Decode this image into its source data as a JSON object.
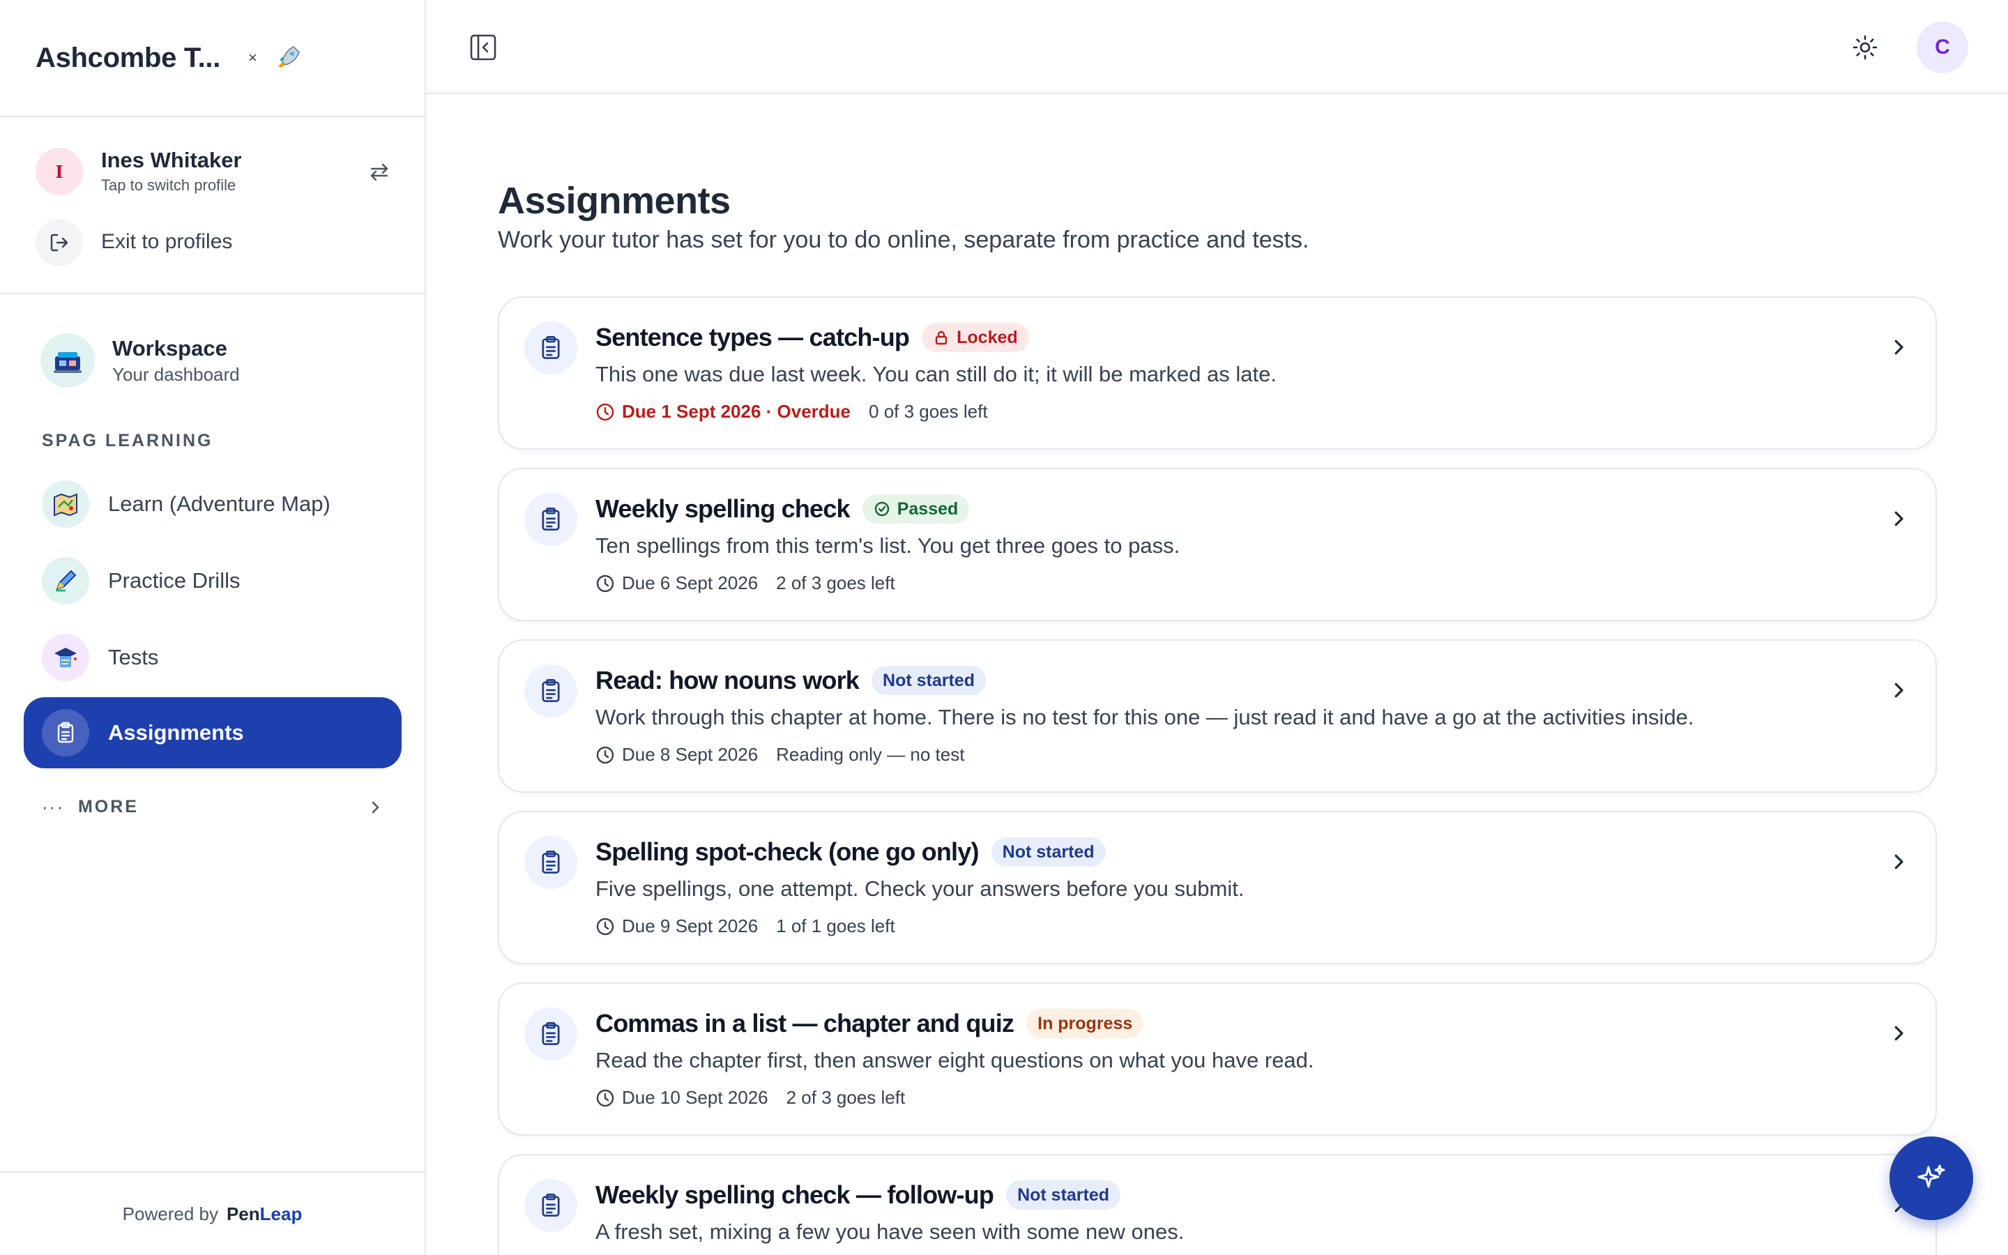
{
  "brand": {
    "title": "Ashcombe T...",
    "close_glyph": "×",
    "rocket_icon": "rocket-icon"
  },
  "profile": {
    "initial": "I",
    "name": "Ines Whitaker",
    "hint": "Tap to switch profile",
    "exit_label": "Exit to profiles"
  },
  "nav": {
    "workspace": {
      "title": "Workspace",
      "subtitle": "Your dashboard"
    },
    "section_label": "SPAG LEARNING",
    "items": [
      {
        "label": "Learn (Adventure Map)",
        "icon": "map-icon"
      },
      {
        "label": "Practice Drills",
        "icon": "pencil-icon"
      },
      {
        "label": "Tests",
        "icon": "graduation-cap-icon"
      },
      {
        "label": "Assignments",
        "icon": "clipboard-icon",
        "active": true
      }
    ],
    "more_label": "MORE",
    "more_dots": "···"
  },
  "footer": {
    "powered_by": "Powered by",
    "brand_pen": "Pen",
    "brand_leap": "Leap"
  },
  "topbar": {
    "user_initial": "C"
  },
  "page": {
    "title": "Assignments",
    "subtitle": "Work your tutor has set for you to do online, separate from practice and tests."
  },
  "assignments": [
    {
      "title": "Sentence types — catch-up",
      "status": "Locked",
      "description": "This one was due last week. You can still do it; it will be marked as late.",
      "due": "Due 1 Sept 2026 · Overdue",
      "extra": "0 of 3 goes left"
    },
    {
      "title": "Weekly spelling check",
      "status": "Passed",
      "description": "Ten spellings from this term's list. You get three goes to pass.",
      "due": "Due 6 Sept 2026",
      "extra": "2 of 3 goes left"
    },
    {
      "title": "Read: how nouns work",
      "status": "Not started",
      "description": "Work through this chapter at home. There is no test for this one — just read it and have a go at the activities inside.",
      "due": "Due 8 Sept 2026",
      "extra": "Reading only — no test"
    },
    {
      "title": "Spelling spot-check (one go only)",
      "status": "Not started",
      "description": "Five spellings, one attempt. Check your answers before you submit.",
      "due": "Due 9 Sept 2026",
      "extra": "1 of 1 goes left"
    },
    {
      "title": "Commas in a list — chapter and quiz",
      "status": "In progress",
      "description": "Read the chapter first, then answer eight questions on what you have read.",
      "due": "Due 10 Sept 2026",
      "extra": "2 of 3 goes left"
    },
    {
      "title": "Weekly spelling check — follow-up",
      "status": "Not started",
      "description": "A fresh set, mixing a few you have seen with some new ones.",
      "due": "",
      "extra": ""
    }
  ],
  "colors": {
    "accent": "#1e40af",
    "locked": "#b91c1c",
    "passed": "#166534",
    "in_progress": "#9a3412"
  }
}
